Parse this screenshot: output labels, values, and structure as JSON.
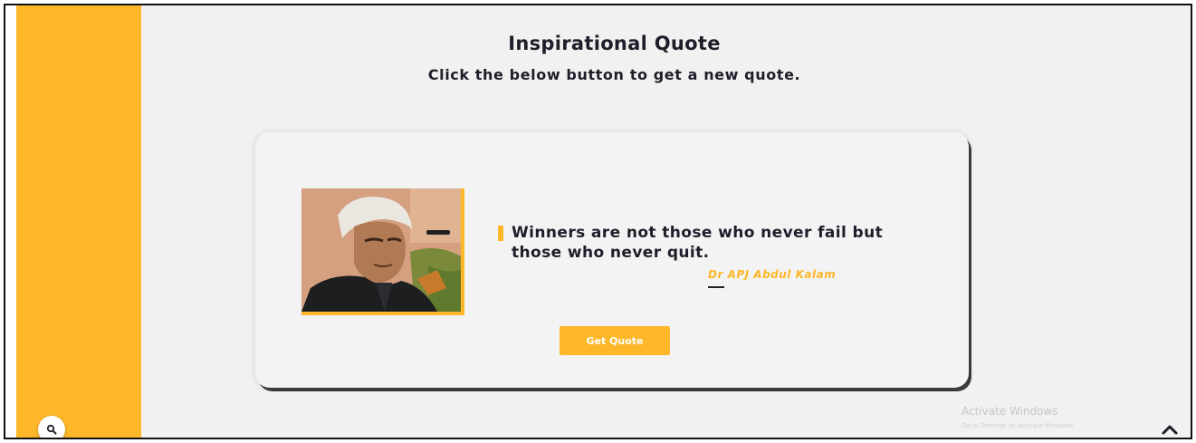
{
  "header": {
    "title": "Inspirational Quote",
    "subtitle": "Click the below button to get a new quote."
  },
  "quote": {
    "text": "Winners are not those who never fail but those who never quit.",
    "author": "Dr APJ Abdul Kalam"
  },
  "actions": {
    "get_quote_label": "Get Quote"
  },
  "watermark": {
    "title": "Activate Windows",
    "subtitle": "Go to Settings to activate Windows."
  },
  "icons": {
    "search": "search-icon",
    "scroll_top": "chevron-up-icon",
    "quote_marker": "quote-marker-icon"
  },
  "colors": {
    "accent": "#fdb728",
    "background": "#f1f1f1",
    "text": "#1e1e2a",
    "button_text": "#ffffff"
  }
}
